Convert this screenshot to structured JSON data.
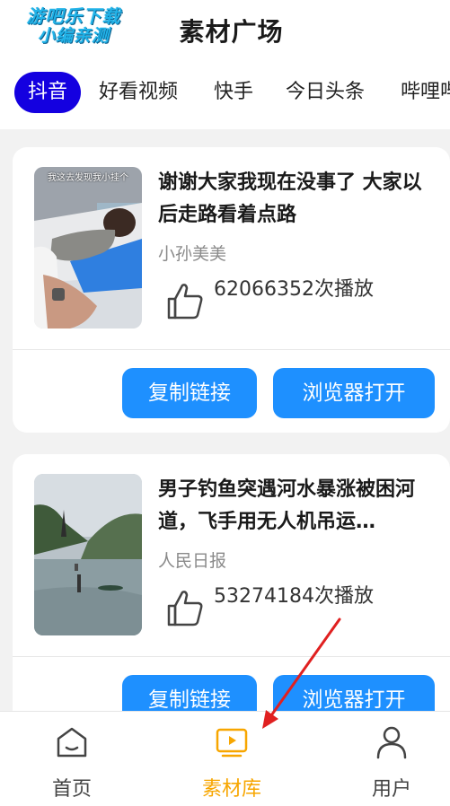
{
  "header": {
    "watermark_line1": "游吧乐下载",
    "watermark_line2": "小编亲测",
    "title": "素材广场"
  },
  "tabs": [
    {
      "label": "抖音",
      "active": true
    },
    {
      "label": "好看视频",
      "active": false
    },
    {
      "label": "快手",
      "active": false
    },
    {
      "label": "今日头条",
      "active": false
    },
    {
      "label": "哔哩哔",
      "active": false
    }
  ],
  "videos": [
    {
      "thumb_caption": "我这去发现我小挂个",
      "title": "谢谢大家我现在没事了 大家以后走路看着点路",
      "author": "小孙美美",
      "plays": "62066352次播放",
      "copy_label": "复制链接",
      "open_label": "浏览器打开"
    },
    {
      "title": "男子钓鱼突遇河水暴涨被困河道，飞手用无人机吊运…",
      "author": "人民日报",
      "plays": "53274184次播放",
      "copy_label": "复制链接",
      "open_label": "浏览器打开"
    }
  ],
  "nav": [
    {
      "label": "首页",
      "icon": "home-icon",
      "active": false
    },
    {
      "label": "素材库",
      "icon": "tv-library-icon",
      "active": true
    },
    {
      "label": "用户",
      "icon": "user-icon",
      "active": false
    }
  ],
  "colors": {
    "tab_active_bg": "#1400e0",
    "button_bg": "#1e90ff",
    "nav_active": "#f7a600",
    "annotation_arrow": "#e02020",
    "watermark": "#22b3e8"
  }
}
